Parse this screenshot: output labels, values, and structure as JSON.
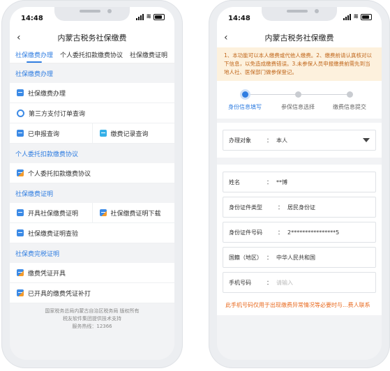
{
  "status": {
    "time": "14:48"
  },
  "left": {
    "title": "内蒙古税务社保缴费",
    "tabs": [
      "社保缴费办理",
      "个人委托扣款缴费协议",
      "社保缴费证明"
    ],
    "sections": [
      {
        "header": "社保缴费办理",
        "rows": [
          {
            "cells": [
              {
                "icon": "pay-icon",
                "label": "社保缴费办理"
              }
            ]
          },
          {
            "cells": [
              {
                "icon": "order-search-icon",
                "label": "第三方支付订单查询"
              }
            ]
          },
          {
            "cells": [
              {
                "icon": "declared-search-icon",
                "label": "已申报查询"
              },
              {
                "icon": "record-icon",
                "label": "缴费记录查询"
              }
            ]
          }
        ]
      },
      {
        "header": "个人委托扣款缴费协议",
        "rows": [
          {
            "cells": [
              {
                "icon": "agreement-icon",
                "label": "个人委托扣款缴费协议"
              }
            ]
          }
        ]
      },
      {
        "header": "社保缴费证明",
        "rows": [
          {
            "cells": [
              {
                "icon": "certificate-icon",
                "label": "开具社保缴费证明"
              },
              {
                "icon": "download-icon",
                "label": "社保缴费证明下载"
              }
            ]
          },
          {
            "cells": [
              {
                "icon": "verify-icon",
                "label": "社保缴费证明查验"
              }
            ]
          }
        ]
      },
      {
        "header": "社保费完税证明",
        "rows": [
          {
            "cells": [
              {
                "icon": "voucher-icon",
                "label": "缴费凭证开具"
              }
            ]
          },
          {
            "cells": [
              {
                "icon": "reprint-icon",
                "label": "已开具的缴费凭证补打"
              }
            ]
          }
        ]
      }
    ],
    "footer": [
      "国家税务总局内蒙古自治区税务局 版权所有",
      "税友软件集团提供技术支持",
      "服务热线：12366"
    ]
  },
  "right": {
    "title": "内蒙古税务社保缴费",
    "notice": "1、本功能可以本人缴费或代他人缴费。2、缴费前请认真核对以下信息，以免造成缴费错误。3.未参保人员申报缴费前需先到当地人社、医保部门做参保登记。",
    "steps": [
      "身份信息填写",
      "参保信息选择",
      "缴费信息提交"
    ],
    "object": {
      "label": "办理对象",
      "value": "本人"
    },
    "fields": [
      {
        "label": "姓名",
        "value": "**博"
      },
      {
        "label": "身份证件类型",
        "value": "居民身份证"
      },
      {
        "label": "身份证件号码",
        "value": "2****************5"
      },
      {
        "label": "国籍（地区）",
        "value": "中华人民共和国"
      }
    ],
    "phone": {
      "label": "手机号码",
      "placeholder": "请输入"
    },
    "warning": "此手机号码仅用于出现缴费异常情况等必要时与...费人联系",
    "colon": "："
  }
}
